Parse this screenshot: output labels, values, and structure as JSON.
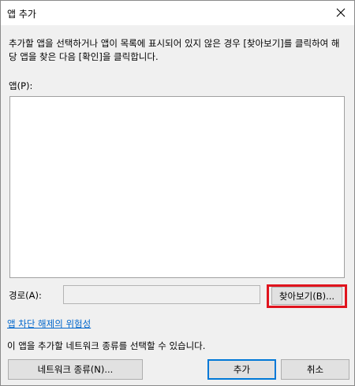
{
  "window": {
    "title": "앱 추가",
    "close_icon": "close-icon"
  },
  "instruction": "추가할 앱을 선택하거나 앱이 목록에 표시되어 있지 않은 경우 [찾아보기]를 클릭하여 해당 앱을 찾은 다음 [확인]을 클릭합니다.",
  "apps": {
    "label": "앱(P):",
    "items": []
  },
  "path": {
    "label": "경로(A):",
    "value": "",
    "browse_label": "찾아보기(B)..."
  },
  "risk_link": "앱 차단 해제의 위험성",
  "info_text": "이 앱을 추가할 네트워크 종류를 선택할 수 있습니다.",
  "buttons": {
    "network_type": "네트워크 종류(N)...",
    "add": "추가",
    "cancel": "취소"
  },
  "colors": {
    "highlight": "#e0141e",
    "link": "#0066cc",
    "default_button_border": "#0078d7"
  }
}
